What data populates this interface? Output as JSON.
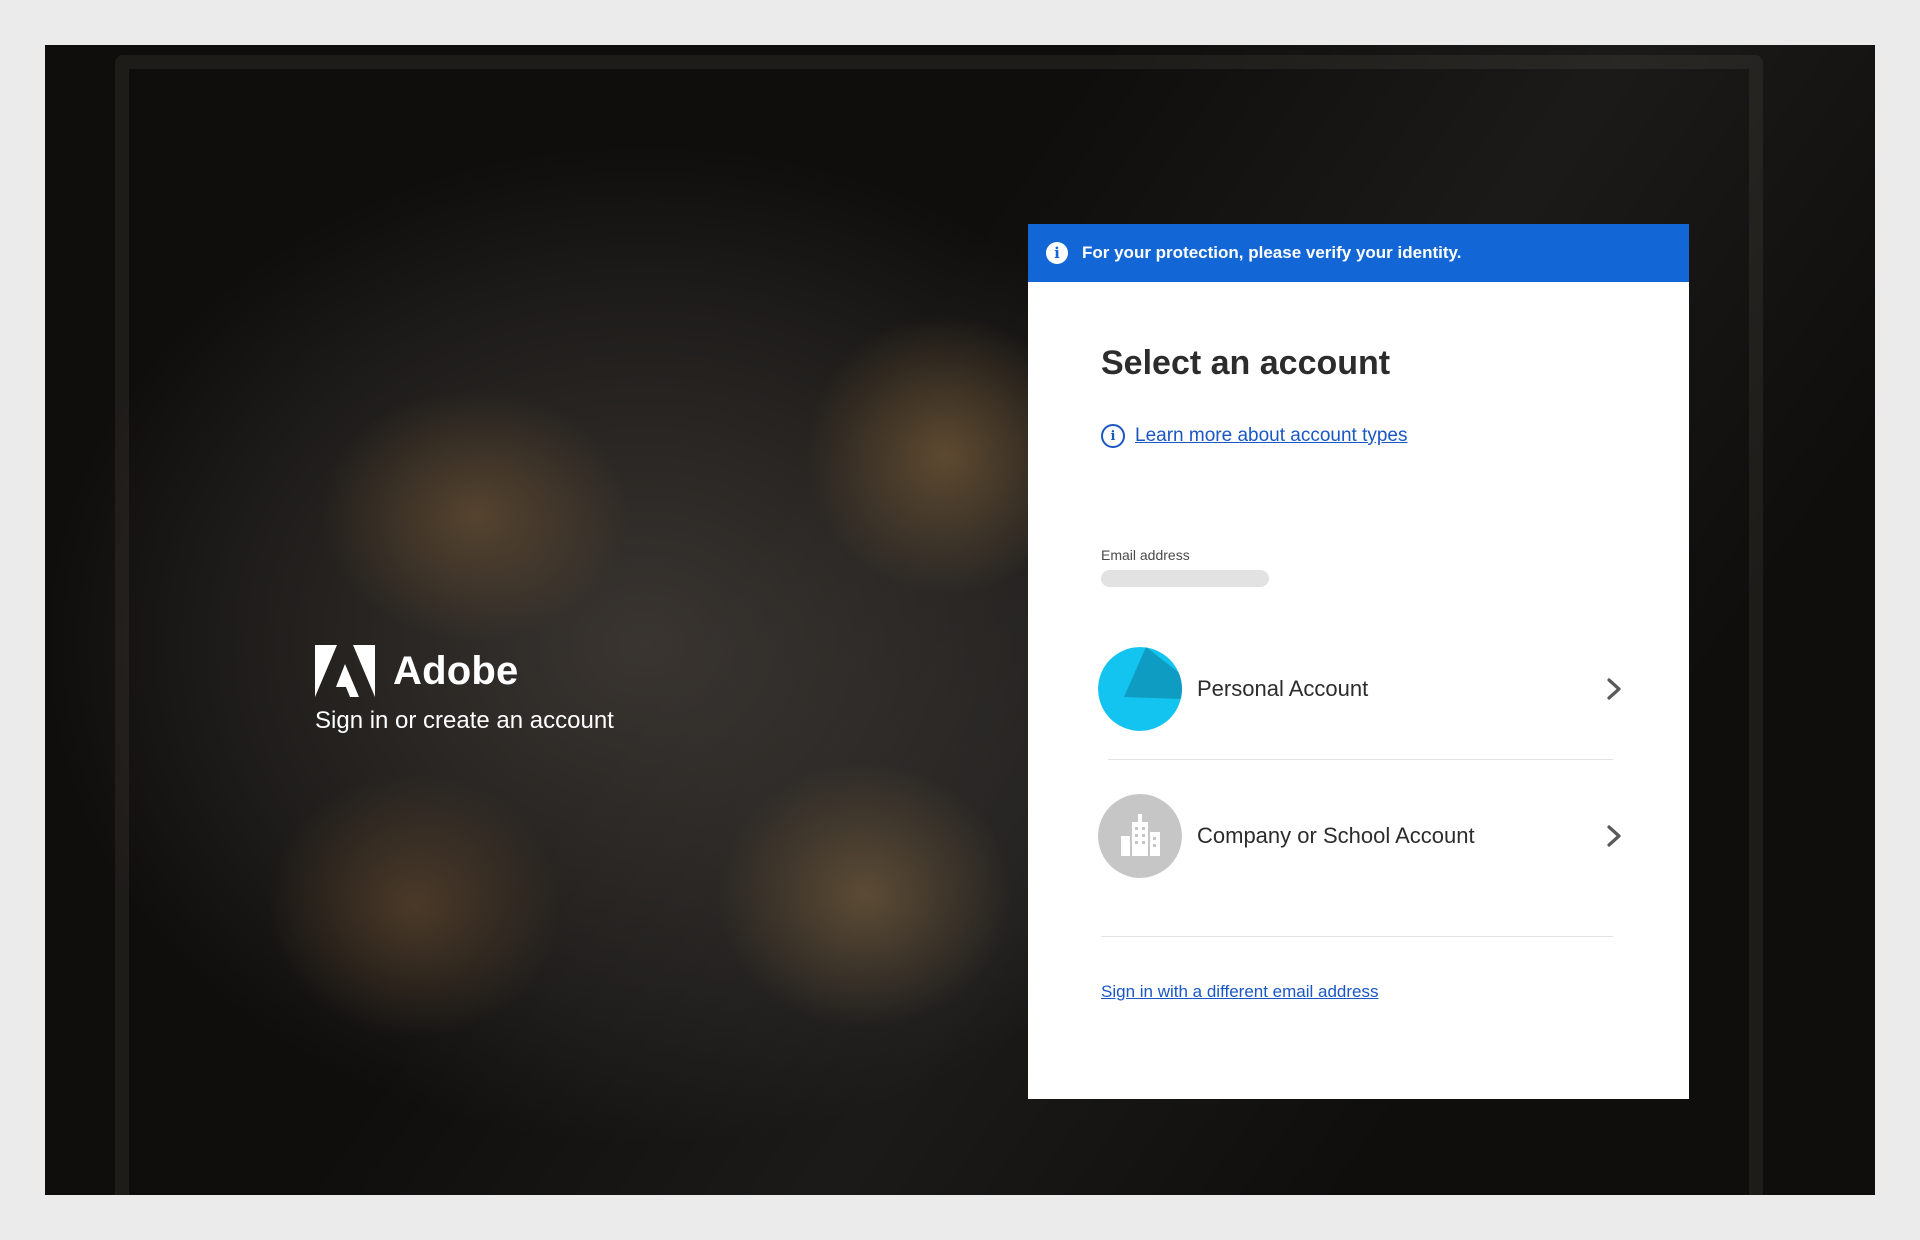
{
  "brand": {
    "name": "Adobe",
    "subtitle": "Sign in or create an account",
    "logo_icon": "adobe-logo-icon"
  },
  "banner": {
    "icon": "info-icon",
    "text": "For your protection, please verify your identity.",
    "color": "#1366d6"
  },
  "card": {
    "title": "Select an account",
    "learn_more_link": "Learn more about account types",
    "email_label": "Email address",
    "email_value": "",
    "accounts": [
      {
        "label": "Personal Account",
        "icon": "personal-account-avatar-icon",
        "color": "#12c4ef"
      },
      {
        "label": "Company or School Account",
        "icon": "building-icon",
        "color": "#c6c6c6"
      }
    ],
    "different_email_link": "Sign in with a different email address"
  },
  "colors": {
    "link": "#1a57c4",
    "accent": "#1366d6"
  }
}
